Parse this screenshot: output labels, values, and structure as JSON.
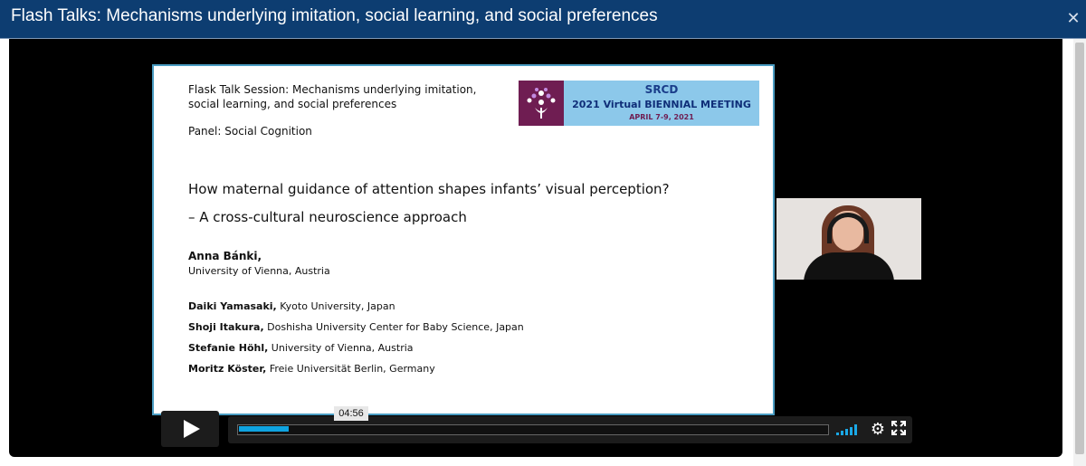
{
  "window": {
    "title": "Flash Talks: Mechanisms underlying imitation, social learning, and social preferences",
    "close_glyph": "✕"
  },
  "slide": {
    "session": "Flask Talk Session: Mechanisms underlying imitation, social learning, and social preferences",
    "panel": "Panel: Social Cognition",
    "talk_title_line1": "How maternal guidance of attention shapes infants’ visual perception?",
    "talk_title_line2": "– A cross-cultural neuroscience approach",
    "presenter": {
      "name": "Anna Bánki,",
      "affiliation": "University of Vienna, Austria"
    },
    "coauthors": [
      {
        "name": "Daiki Yamasaki,",
        "affiliation": " Kyoto University, Japan"
      },
      {
        "name": "Shoji Itakura,",
        "affiliation": " Doshisha University Center for Baby Science, Japan"
      },
      {
        "name": "Stefanie Höhl,",
        "affiliation": " University of Vienna, Austria"
      },
      {
        "name": "Moritz Köster,",
        "affiliation": " Freie Universität Berlin, Germany"
      }
    ],
    "banner": {
      "org": "SRCD",
      "meeting": "2021 Virtual BIENNIAL MEETING",
      "dates": "APRIL 7-9, 2021",
      "colors": {
        "tree_bg": "#6f1d52",
        "banner_bg": "#8cc8ea"
      }
    }
  },
  "player": {
    "current_time": "04:56",
    "progress_fraction": 0.085,
    "play_icon": "play-icon",
    "volume_icon": "volume-bars-icon",
    "settings_icon": "gear-icon",
    "settings_glyph": "⚙",
    "fullscreen_icon": "fullscreen-icon",
    "accent_color": "#0fa3e0"
  }
}
